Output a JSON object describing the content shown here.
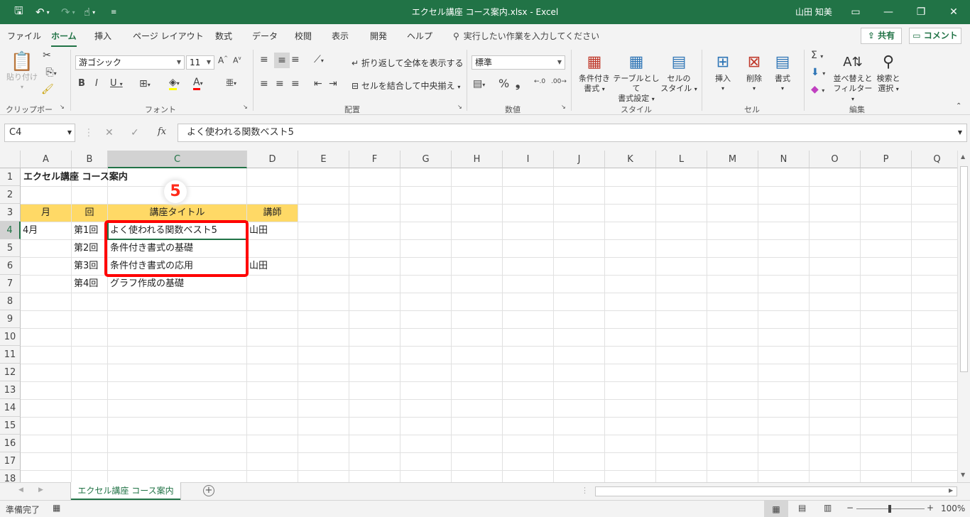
{
  "titlebar": {
    "title": "エクセル講座 コース案内.xlsx  -  Excel",
    "user": "山田 知美"
  },
  "ribbon_tabs": [
    "ファイル",
    "ホーム",
    "挿入",
    "ページ レイアウト",
    "数式",
    "データ",
    "校閲",
    "表示",
    "開発",
    "ヘルプ"
  ],
  "tell_me": "実行したい作業を入力してください",
  "share_label": "共有",
  "comment_label": "コメント",
  "ribbon": {
    "paste_label": "貼り付け",
    "font_name": "游ゴシック",
    "font_size": "11",
    "wrap_text": "折り返して全体を表示する",
    "merge_center": "セルを結合して中央揃え",
    "number_format": "標準",
    "cond_format": [
      "条件付き",
      "書式"
    ],
    "table_format": [
      "テーブルとして",
      "書式設定"
    ],
    "cell_style": [
      "セルの",
      "スタイル"
    ],
    "insert": "挿入",
    "delete": "削除",
    "format": "書式",
    "sort_filter": [
      "並べ替えと",
      "フィルター"
    ],
    "find_select": [
      "検索と",
      "選択"
    ],
    "groups": {
      "clipboard": "クリップボード",
      "font": "フォント",
      "alignment": "配置",
      "number": "数値",
      "styles": "スタイル",
      "cells": "セル",
      "editing": "編集"
    }
  },
  "namebox": "C4",
  "formula": "よく使われる関数ベスト5",
  "columns": [
    "A",
    "B",
    "C",
    "D",
    "E",
    "F",
    "G",
    "H",
    "I",
    "J",
    "K",
    "L",
    "M",
    "N",
    "O",
    "P",
    "Q"
  ],
  "rows": [
    "1",
    "2",
    "3",
    "4",
    "5",
    "6",
    "7",
    "8",
    "9",
    "10",
    "11",
    "12",
    "13",
    "14",
    "15",
    "16",
    "17",
    "18"
  ],
  "cells": {
    "a1": "エクセル講座 コース案内",
    "a3": "月",
    "b3": "回",
    "c3": "講座タイトル",
    "d3": "講師",
    "a4": "4月",
    "b4": "第1回",
    "c4": "よく使われる関数ベスト5",
    "d4": "山田",
    "b5": "第2回",
    "c5": "条件付き書式の基礎",
    "b6": "第3回",
    "c6": "条件付き書式の応用",
    "d6": "山田",
    "b7": "第4回",
    "c7": "グラフ作成の基礎"
  },
  "annotation_number": "5",
  "sheet_tab": "エクセル講座 コース案内",
  "status": {
    "ready": "準備完了",
    "zoom": "100%"
  },
  "colors": {
    "accent": "#217346",
    "header_fill": "#ffd966",
    "annotation": "#ff0000"
  }
}
